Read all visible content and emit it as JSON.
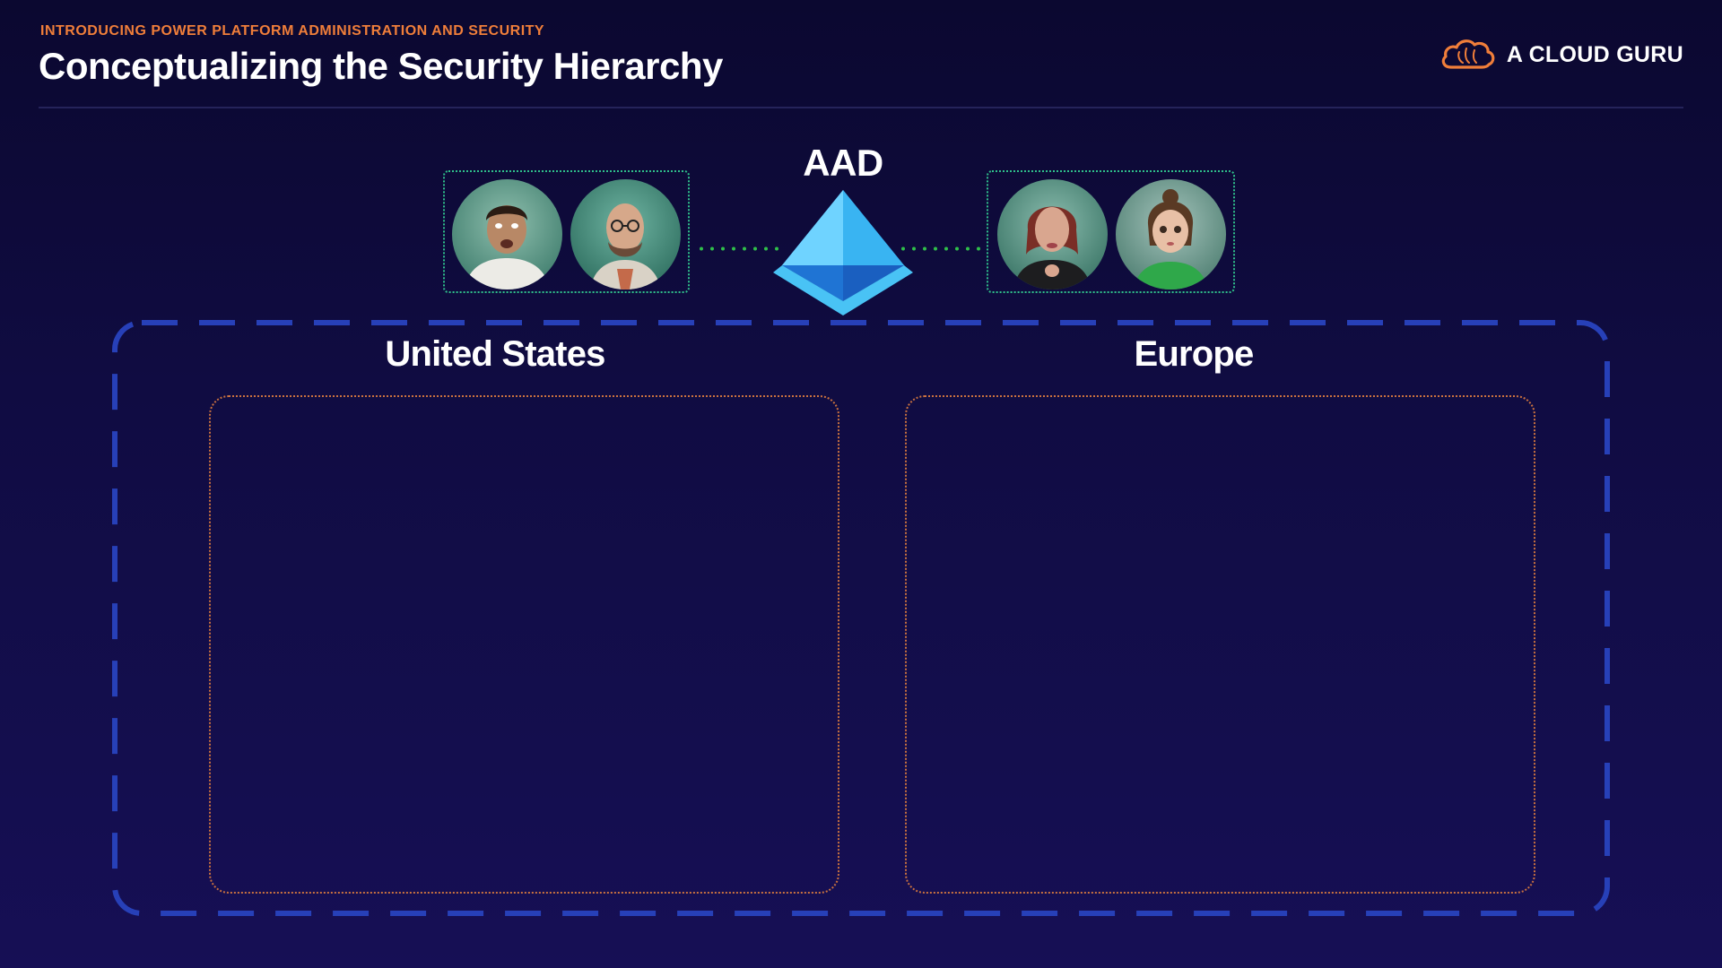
{
  "header": {
    "subtitle": "INTRODUCING POWER PLATFORM ADMINISTRATION AND SECURITY",
    "title": "Conceptualizing the Security Hierarchy"
  },
  "brand": {
    "name": "A CLOUD GURU",
    "icon": "cloud-logo-icon",
    "color": "#f07e3a"
  },
  "aad": {
    "label": "AAD",
    "icon": "azure-active-directory-icon",
    "connector_color": "#2fbf4a"
  },
  "user_groups": [
    {
      "region": "United States",
      "avatars": [
        "user-avatar",
        "user-avatar"
      ],
      "border_color": "#2fbf8a"
    },
    {
      "region": "Europe",
      "avatars": [
        "user-avatar",
        "user-avatar"
      ],
      "border_color": "#2fbf8a"
    }
  ],
  "regions": [
    {
      "name": "United States",
      "border_color": "#c9713f"
    },
    {
      "name": "Europe",
      "border_color": "#c9713f"
    }
  ],
  "outer_frame_color": "#2740b8"
}
